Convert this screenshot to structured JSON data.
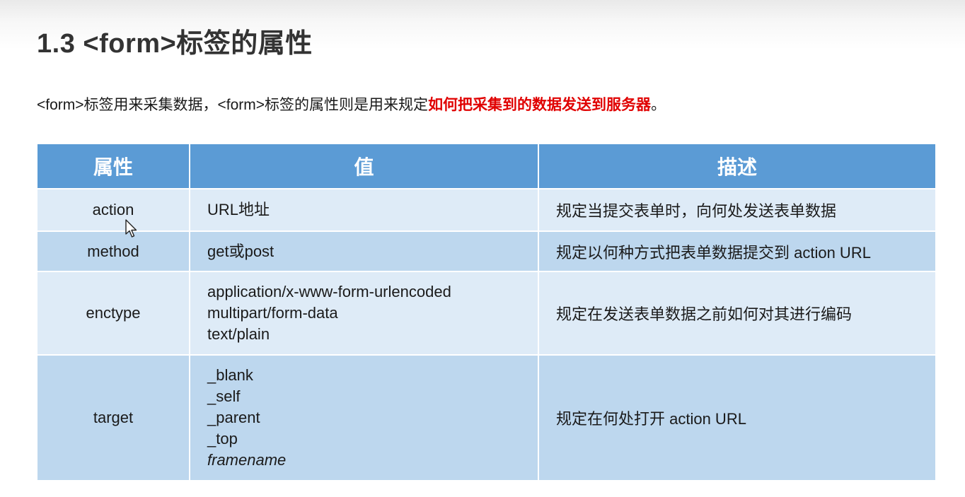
{
  "slide": {
    "title": "1.3 <form>标签的属性",
    "intro": {
      "text": "<form>标签用来采集数据，<form>标签的属性则是用来规定",
      "highlight": "如何把采集到的数据发送到服务器",
      "suffix": "。",
      "highlight_color": "#e00000"
    }
  },
  "table": {
    "headers": [
      "属性",
      "值",
      "描述"
    ],
    "header_color": "#5b9bd5",
    "row_colors": [
      "#deebf7",
      "#bdd7ee"
    ],
    "rows": [
      {
        "attribute": "action",
        "values": [
          "URL地址"
        ],
        "description": "规定当提交表单时，向何处发送表单数据"
      },
      {
        "attribute": "method",
        "values": [
          "get或post"
        ],
        "description": "规定以何种方式把表单数据提交到 action URL"
      },
      {
        "attribute": "enctype",
        "values": [
          "application/x-www-form-urlencoded",
          "multipart/form-data",
          "text/plain"
        ],
        "description": "规定在发送表单数据之前如何对其进行编码"
      },
      {
        "attribute": "target",
        "values": [
          "_blank",
          "_self",
          "_parent",
          "_top",
          "framename"
        ],
        "description": "规定在何处打开 action URL"
      }
    ]
  },
  "cursor": {
    "icon": "mouse-pointer-icon"
  }
}
